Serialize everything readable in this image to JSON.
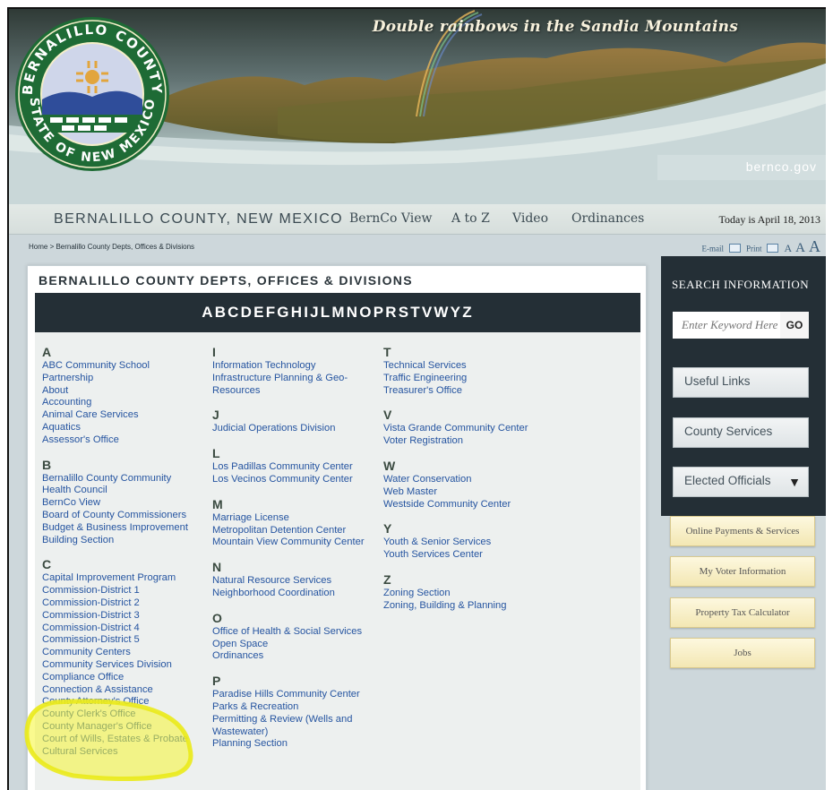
{
  "banner": {
    "caption": "Double rainbows in the Sandia Mountains",
    "site_domain": "bernco.gov",
    "seal_text_top": "BERNALILLO COUNTY",
    "seal_text_bottom": "STATE OF NEW MEXICO"
  },
  "nav": {
    "site_title": "BERNALILLO COUNTY, NEW MEXICO",
    "links": [
      "BernCo View",
      "A to Z",
      "Video",
      "Ordinances"
    ],
    "today": "Today is April 18, 2013"
  },
  "breadcrumb": "Home > Bernalillo County Depts, Offices & Divisions",
  "tools": {
    "email": "E-mail",
    "print": "Print",
    "sizes": [
      "A",
      "A",
      "A"
    ]
  },
  "panel": {
    "title": "BERNALILLO COUNTY DEPTS, OFFICES & DIVISIONS",
    "alphabet": [
      "A",
      "B",
      "C",
      "D",
      "E",
      "F",
      "G",
      "H",
      "I",
      "J",
      "L",
      "M",
      "N",
      "O",
      "P",
      "R",
      "S",
      "T",
      "V",
      "W",
      "Y",
      "Z"
    ]
  },
  "groups": {
    "A": [
      "ABC Community School",
      "Partnership",
      "About",
      "Accounting",
      "Animal Care Services",
      "Aquatics",
      "Assessor's Office"
    ],
    "B": [
      "Bernalillo County Community",
      "Health Council",
      "BernCo View",
      "Board of County Commissioners",
      "Budget & Business Improvement",
      "Building Section"
    ],
    "C": [
      "Capital Improvement Program",
      "Commission-District 1",
      "Commission-District 2",
      "Commission-District 3",
      "Commission-District 4",
      "Commission-District 5",
      "Community Centers",
      "Community Services Division",
      "Compliance Office",
      "Connection & Assistance",
      "County Attorney's Office",
      "County Clerk's Office",
      "County Manager's Office",
      "Court of Wills, Estates & Probate",
      "Cultural Services"
    ],
    "I": [
      "Information Technology",
      "Infrastructure Planning & Geo-",
      "Resources"
    ],
    "J": [
      "Judicial Operations Division"
    ],
    "L": [
      "Los Padillas Community Center",
      "Los Vecinos Community Center"
    ],
    "M": [
      "Marriage License",
      "Metropolitan Detention Center",
      "Mountain View Community Center"
    ],
    "N": [
      "Natural Resource Services",
      "Neighborhood Coordination"
    ],
    "O": [
      "Office of Health & Social Services",
      "Open Space",
      "Ordinances"
    ],
    "P": [
      "Paradise Hills Community Center",
      "Parks & Recreation",
      "Permitting & Review (Wells and",
      "Wastewater)",
      "Planning Section"
    ],
    "T": [
      "Technical Services",
      "Traffic Engineering",
      "Treasurer's Office"
    ],
    "V": [
      "Vista Grande Community Center",
      "Voter Registration"
    ],
    "W": [
      "Water Conservation",
      "Web Master",
      "Westside Community Center"
    ],
    "Y": [
      "Youth & Senior Services",
      "Youth Services Center"
    ],
    "Z": [
      "Zoning Section",
      "Zoning, Building & Planning"
    ]
  },
  "sidebar": {
    "search_title": "SEARCH INFORMATION",
    "search_placeholder": "Enter Keyword Here",
    "go_label": "GO",
    "buttons": [
      "Useful Links",
      "County Services",
      "Elected Officials"
    ],
    "gold_buttons": [
      "Online Payments & Services",
      "My Voter Information",
      "Property Tax Calculator",
      "Jobs"
    ]
  },
  "colors": {
    "link": "#2554a0",
    "dark_bar": "#242f36",
    "highlight": "#f5f531"
  }
}
